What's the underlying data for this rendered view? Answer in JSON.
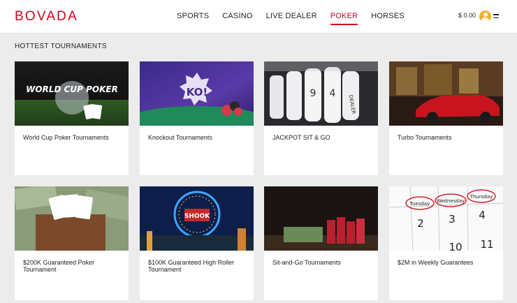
{
  "header": {
    "logo": "BOVADA",
    "nav": [
      "SPORTS",
      "CASINO",
      "LIVE DEALER",
      "POKER",
      "HORSES"
    ],
    "balance": "$ 0.00"
  },
  "section_title": "HOTTEST TOURNAMENTS",
  "tournaments": [
    {
      "title": "World Cup Poker Tournaments",
      "image_text": "WORLD CUP POKER"
    },
    {
      "title": "Knockout Tournaments",
      "image_text": "KO!"
    },
    {
      "title": "JACKPOT SIT & GO",
      "image_text": "DEALER"
    },
    {
      "title": "Turbo Tournaments"
    },
    {
      "title": "$200K Guaranteed Poker Tournament"
    },
    {
      "title": "$100K Guaranteed High Roller Tournament",
      "image_text": "SHOOK"
    },
    {
      "title": "Sit-and-Go Tournaments"
    },
    {
      "title": "$2M in Weekly Guarantees",
      "image_text": [
        "Tuesday",
        "Wednesday",
        "Thursday",
        "2",
        "3",
        "4",
        "10",
        "11"
      ]
    }
  ]
}
